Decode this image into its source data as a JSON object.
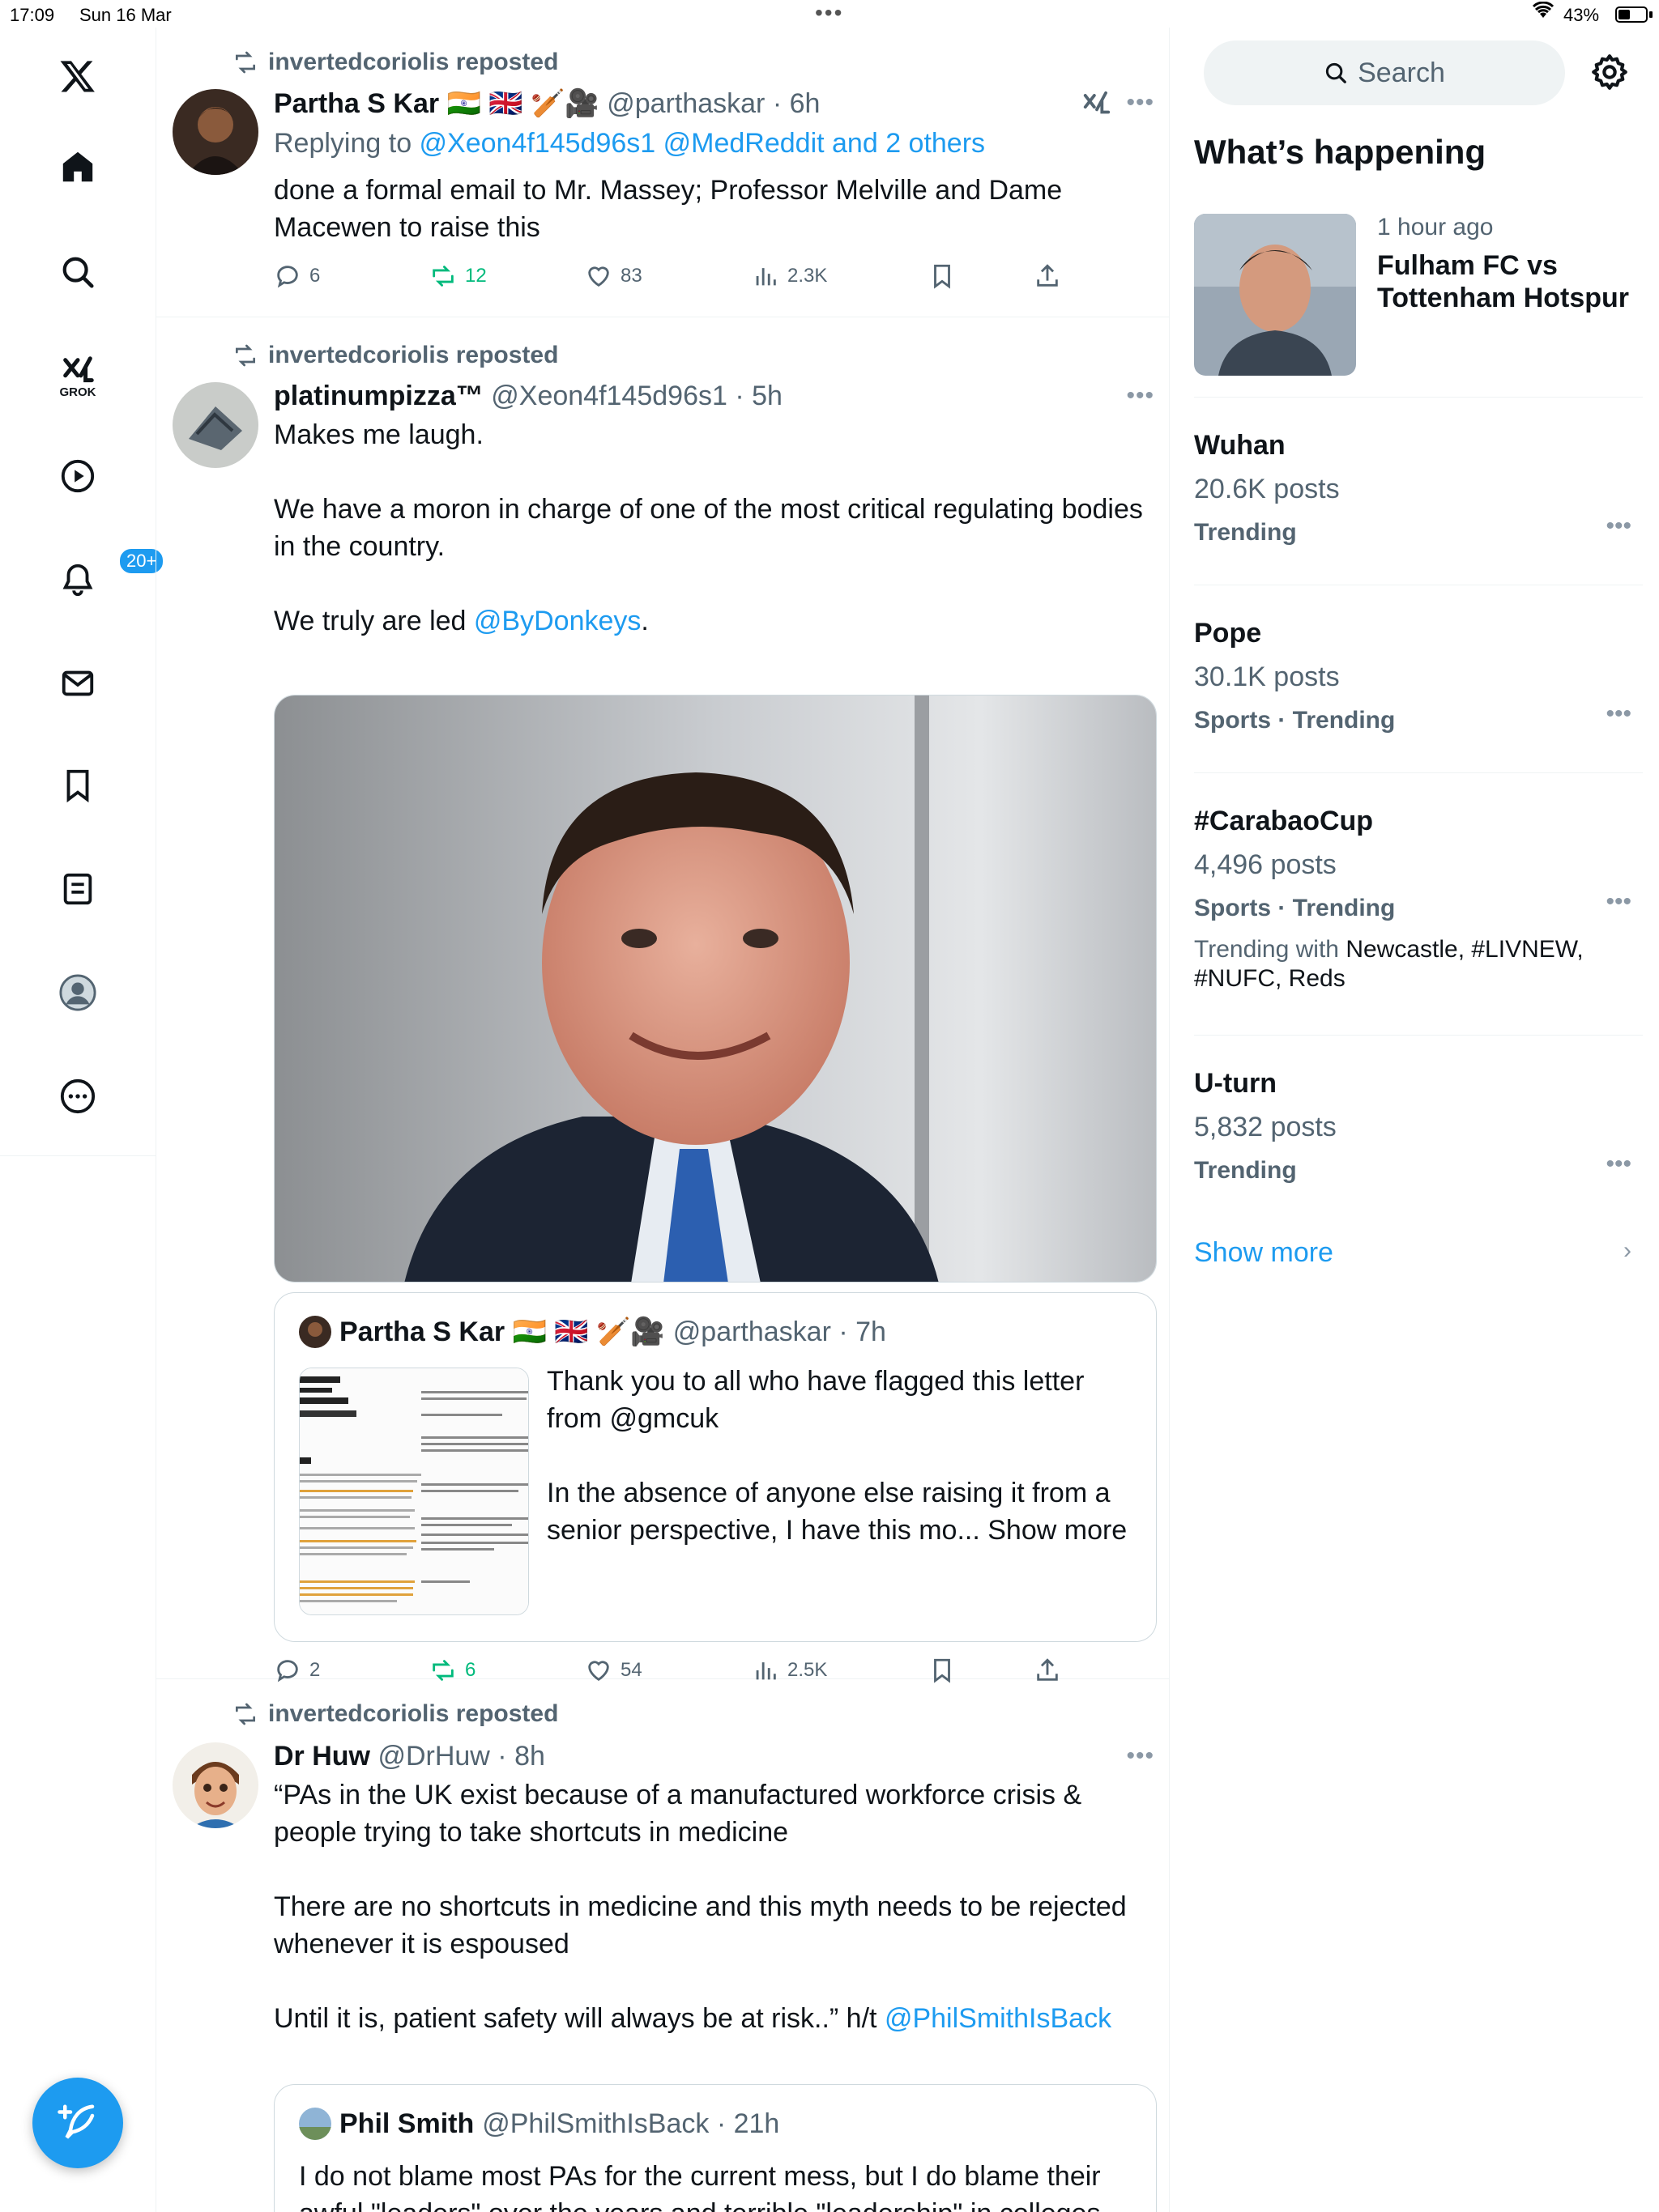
{
  "status": {
    "time": "17:09",
    "date": "Sun 16 Mar",
    "battery_pct": "43%"
  },
  "nav": {
    "grok_label": "GROK",
    "notifications_badge": "20+"
  },
  "tweets": [
    {
      "repost_label": "invertedcoriolis reposted",
      "name": "Partha S Kar 🇮🇳 🇬🇧 🏏🎥",
      "handle": "@parthaskar · 6h",
      "reply_prefix": "Replying to ",
      "reply_targets": "@Xeon4f145d96s1 @MedReddit and 2 others",
      "text": "done a formal email to Mr. Massey; Professor Melville and Dame Macewen to raise this",
      "replies": "6",
      "reposts": "12",
      "likes": "83",
      "views": "2.3K"
    },
    {
      "repost_label": "invertedcoriolis reposted",
      "name": "platinumpizza™",
      "handle": "@Xeon4f145d96s1 · 5h",
      "text_1": "Makes me laugh.\n\nWe have a moron in charge of one of the most critical regulating bodies in the country.\n\nWe truly are led ",
      "text_link": "@ByDonkeys",
      "text_end": ".",
      "quote": {
        "name": "Partha S Kar 🇮🇳 🇬🇧 🏏🎥",
        "handle": "@parthaskar · 7h",
        "text": "Thank you to all who have flagged this letter from @gmcuk\n\nIn the absence of anyone else raising it from a senior perspective, I have this mo... Show more"
      },
      "replies": "2",
      "reposts": "6",
      "likes": "54",
      "views": "2.5K"
    },
    {
      "repost_label": "invertedcoriolis reposted",
      "name": "Dr Huw",
      "handle": "@DrHuw · 8h",
      "text_1": "“PAs in the UK exist because of a manufactured workforce crisis & people trying to take shortcuts in medicine\n\nThere are no shortcuts in medicine and this myth needs to be rejected whenever it is espoused\n\nUntil it is, patient safety will always be at risk..” h/t ",
      "text_link": "@PhilSmithIsBack",
      "quote": {
        "name": "Phil Smith",
        "handle": "@PhilSmithIsBack · 21h",
        "text": "I do not blame most PAs for the current mess, but I do blame their awful \"leaders\" over the years and terrible \"leadership\" in colleges, GMC and NHSE. What is being described here is quite simply it"
      }
    }
  ],
  "sidebar": {
    "search_placeholder": "Search",
    "section_title": "What’s happening",
    "event": {
      "time": "1 hour ago",
      "title": "Fulham FC vs Tottenham Hotspur"
    },
    "trends": [
      {
        "name": "Wuhan",
        "posts": "20.6K posts",
        "category": "Trending"
      },
      {
        "name": "Pope",
        "posts": "30.1K posts",
        "category": "Sports · Trending"
      },
      {
        "name": "#CarabaoCup",
        "posts": "4,496 posts",
        "category": "Sports · Trending",
        "with_prefix": "Trending with ",
        "with_list": "Newcastle, #LIVNEW, #NUFC, Reds"
      },
      {
        "name": "U-turn",
        "posts": "5,832 posts",
        "category": "Trending"
      }
    ],
    "show_more": "Show more"
  },
  "colors": {
    "accent": "#1d9bf0",
    "repost_green": "#00ba7c",
    "muted": "#536471"
  }
}
